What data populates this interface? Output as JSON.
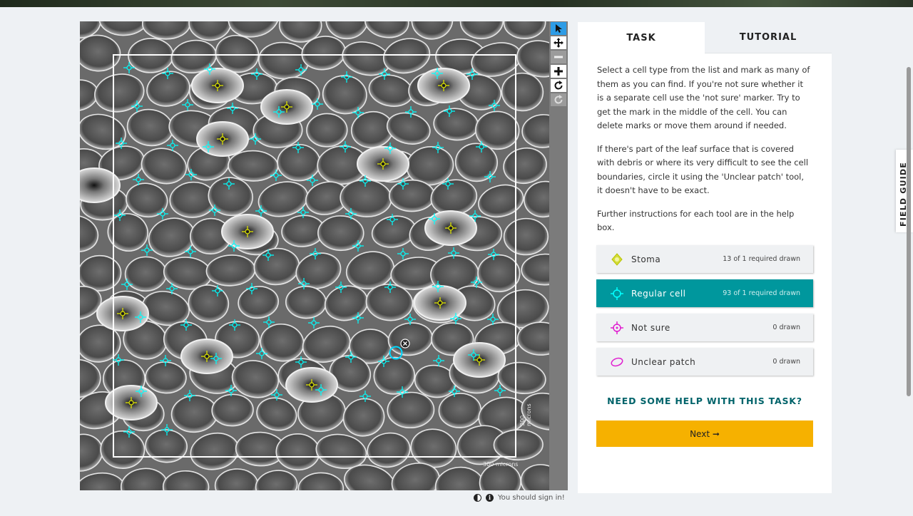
{
  "viewer": {
    "scale_x_label": "300 microns",
    "scale_y_label": "300 microns"
  },
  "toolbar": {
    "tools": [
      {
        "name": "pointer-icon",
        "state": "active"
      },
      {
        "name": "pan-icon",
        "state": "normal"
      },
      {
        "name": "zoom-out-icon",
        "state": "disabled"
      },
      {
        "name": "zoom-in-icon",
        "state": "normal"
      },
      {
        "name": "rotate-icon",
        "state": "normal"
      },
      {
        "name": "reset-icon",
        "state": "disabled"
      }
    ]
  },
  "footer": {
    "sign_in_note": "You should sign in!"
  },
  "panel": {
    "tabs": [
      {
        "label": "TASK",
        "active": true
      },
      {
        "label": "TUTORIAL",
        "active": false
      }
    ],
    "instructions": [
      "Select a cell type from the list and mark as many of them as you can find. If you're not sure whether it is a separate cell use the 'not sure' marker. Try to get the mark in the middle of the cell. You can delete marks or move them around if needed.",
      "If there's part of the leaf surface that is covered with debris or where its very difficult to see the cell boundaries, circle it using the 'Unclear patch' tool, it doesn't have to be exact.",
      "Further instructions for each tool are in the help box."
    ],
    "tools": [
      {
        "label": "Stoma",
        "count": "13 of 1 required drawn",
        "icon": "diamond-marker-icon",
        "color": "#c8d400",
        "selected": false
      },
      {
        "label": "Regular cell",
        "count": "93 of 1 required drawn",
        "icon": "crosshair-marker-icon",
        "color": "#00ffff",
        "selected": true
      },
      {
        "label": "Not sure",
        "count": "0 drawn",
        "icon": "crosshair-marker-icon",
        "color": "#e020d0",
        "selected": false
      },
      {
        "label": "Unclear patch",
        "count": "0 drawn",
        "icon": "ellipse-marker-icon",
        "color": "#e020d0",
        "selected": false
      }
    ],
    "help_link": "NEED SOME HELP WITH THIS TASK?",
    "next_label": "Next ➞"
  },
  "field_guide": {
    "label": "FIELD GUIDE"
  },
  "colors": {
    "accent_teal": "#00979d",
    "next_yellow": "#f6b100",
    "regular_cell_marker": "#00ffff",
    "stoma_marker": "#d8e000",
    "active_tool_blue": "#2d9ce6"
  }
}
